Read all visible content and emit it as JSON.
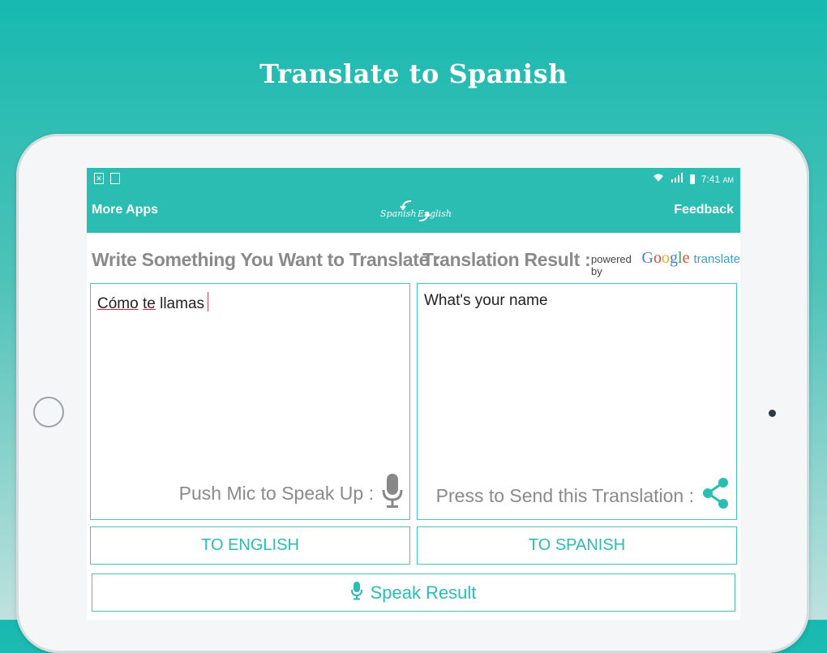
{
  "promo": {
    "title": "Translate to Spanish"
  },
  "status_bar": {
    "time": "7:41",
    "ampm": "AM"
  },
  "app_bar": {
    "left_label": "More Apps",
    "right_label": "Feedback",
    "logo": {
      "left_word": "Spanish",
      "right_word": "English"
    }
  },
  "labels": {
    "input": "Write Something You Want to Translate :",
    "result": "Translation Result :"
  },
  "powered": {
    "prefix": "powered by",
    "brand": "Google",
    "suffix": "translate"
  },
  "input_panel": {
    "text_part1": "Cómo",
    "text_part2": "te",
    "text_part3": "llamas",
    "hint": "Push Mic to Speak Up :"
  },
  "result_panel": {
    "text": "What's your name",
    "hint": "Press to Send this Translation :"
  },
  "buttons": {
    "to_english": "TO ENGLISH",
    "to_spanish": "TO SPANISH",
    "speak_result": "Speak Result"
  },
  "colors": {
    "accent": "#2bbdb2",
    "label_gray": "#8a8a8a"
  }
}
